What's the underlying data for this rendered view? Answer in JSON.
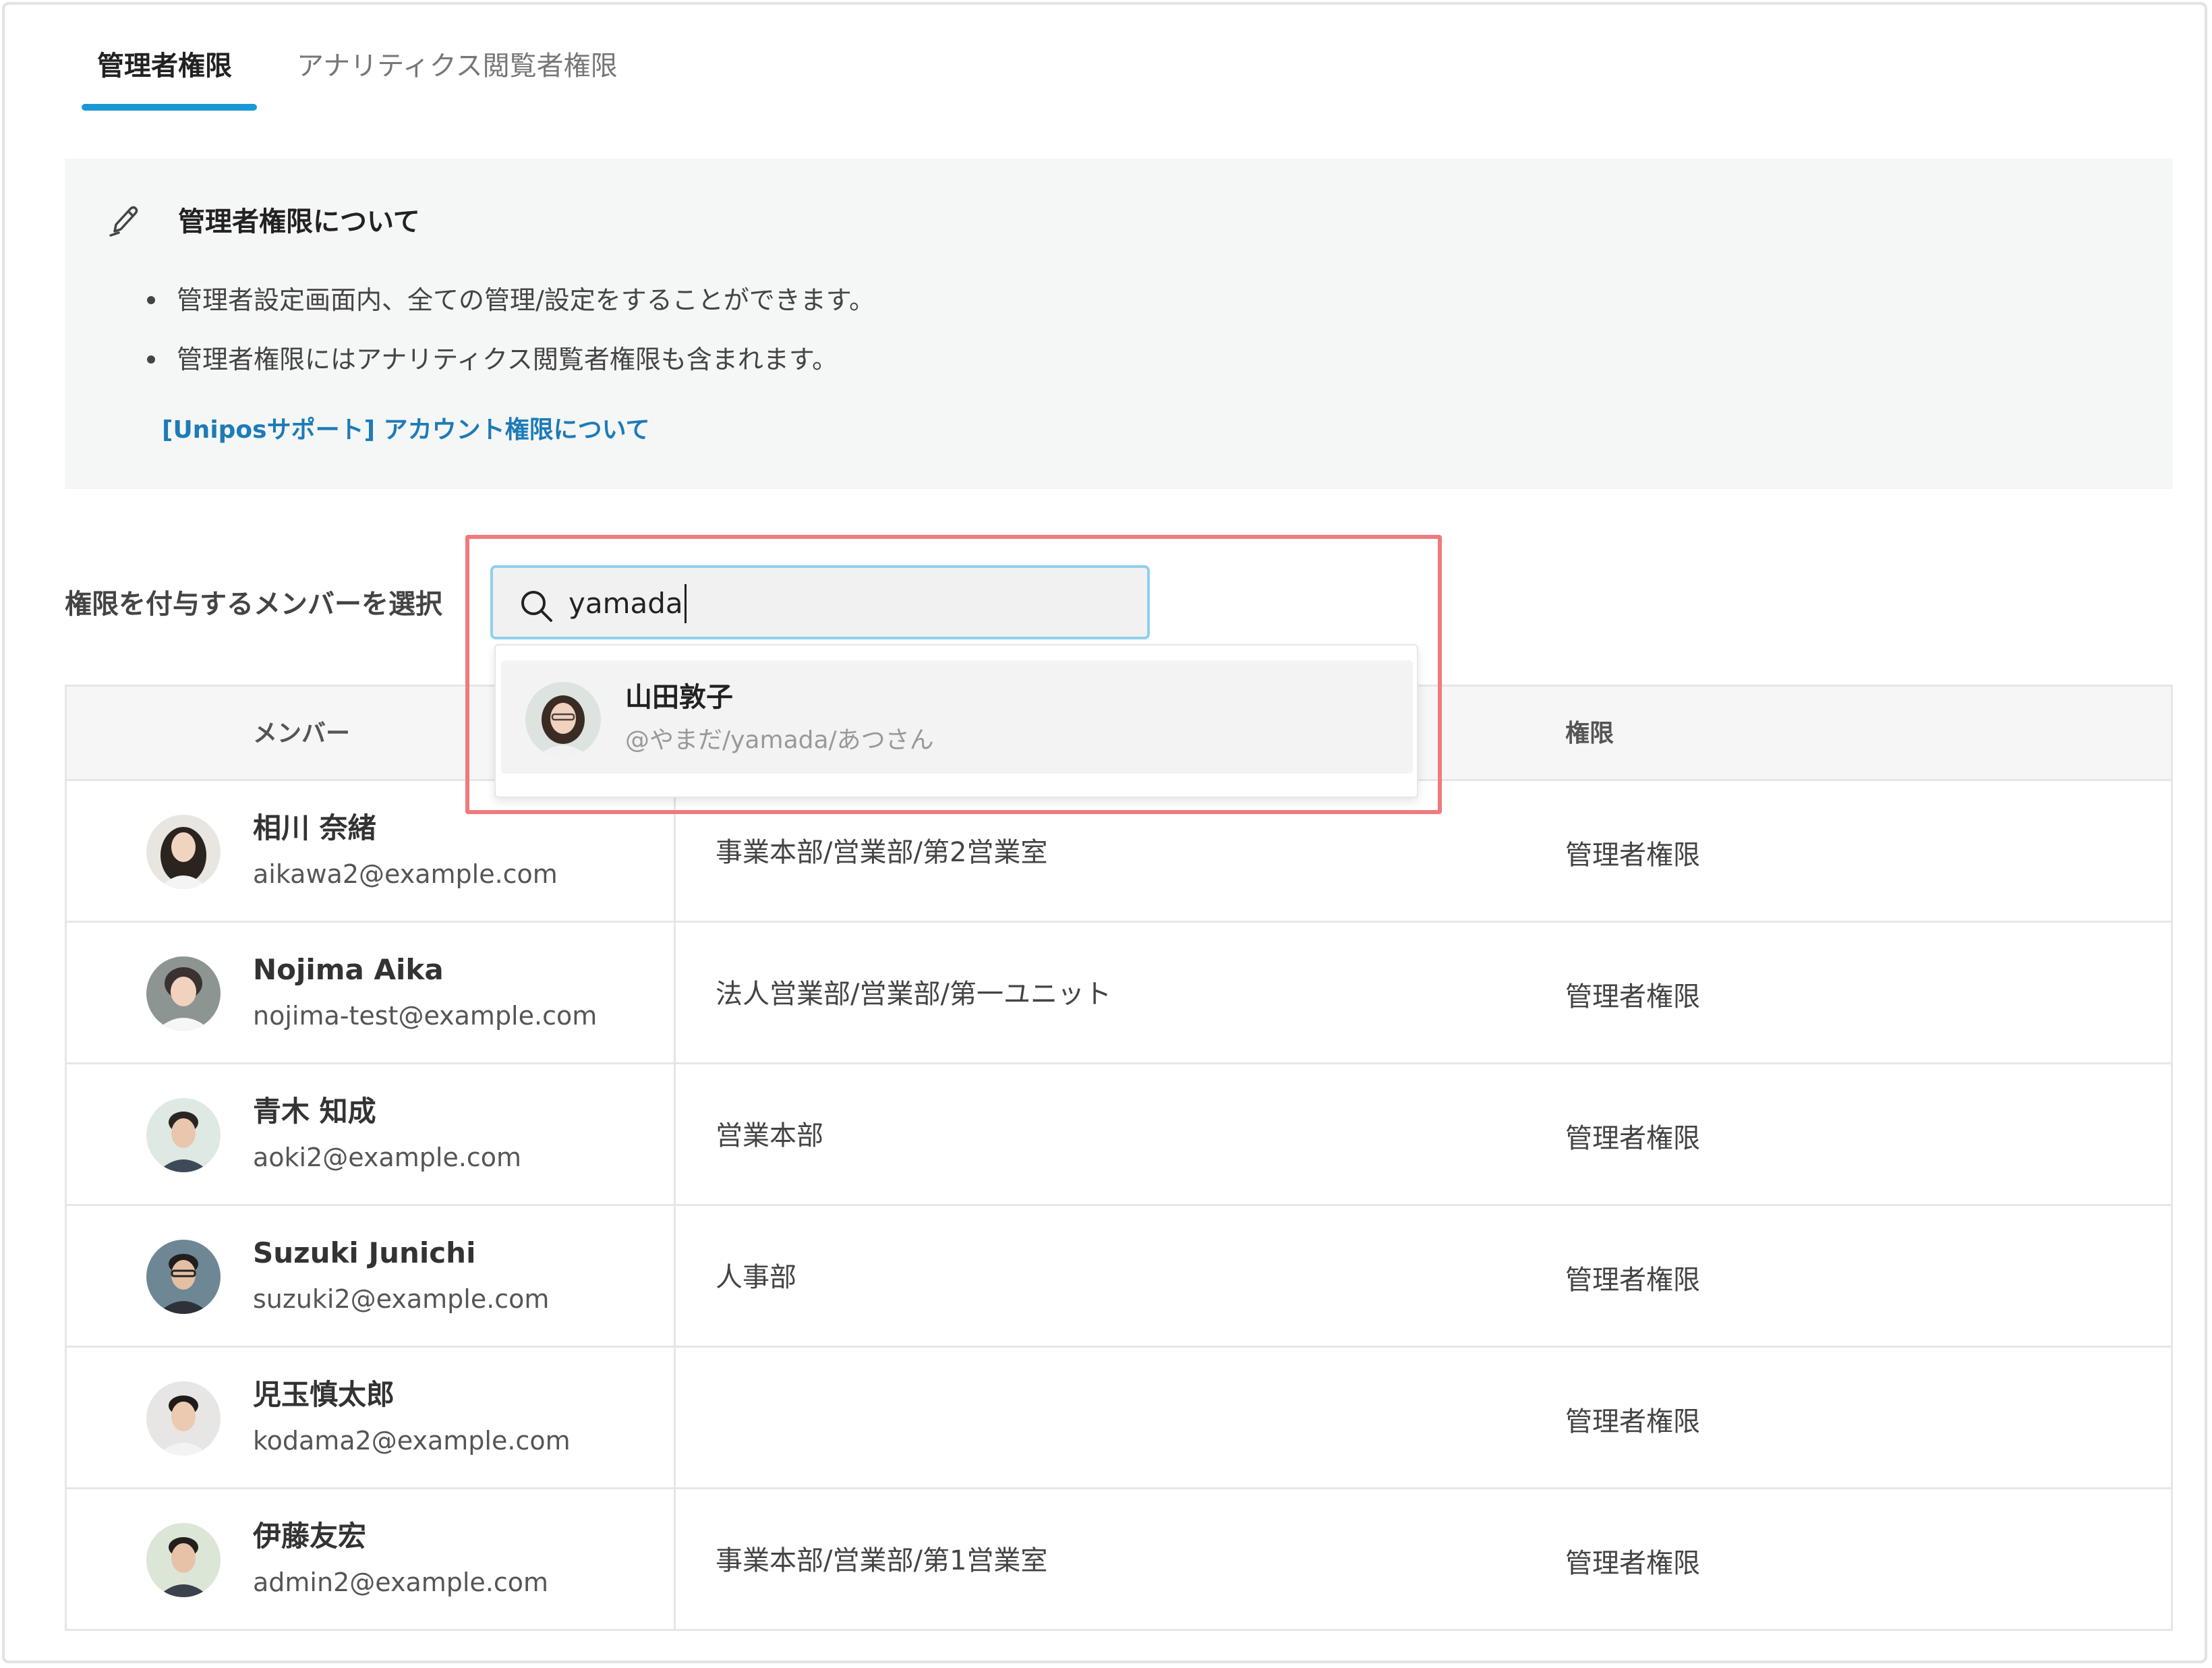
{
  "tabs": [
    {
      "label": "管理者権限",
      "active": true
    },
    {
      "label": "アナリティクス閲覧者権限",
      "active": false
    }
  ],
  "info": {
    "icon": "pencil-icon",
    "title": "管理者権限について",
    "bullets": [
      "管理者設定画面内、全ての管理/設定をすることができます。",
      "管理者権限にはアナリティクス閲覧者権限も含まれます。"
    ],
    "link": "[Uniposサポート] アカウント権限について"
  },
  "select": {
    "label": "権限を付与するメンバーを選択",
    "search_value": "yamada",
    "search_icon": "search-icon"
  },
  "suggestion": {
    "name": "山田敦子",
    "sub": "@やまだ/yamada/あつさん"
  },
  "table": {
    "headers": {
      "member": "メンバー",
      "role": "権限"
    },
    "rows": [
      {
        "name": "相川 奈緒",
        "email": "aikawa2@example.com",
        "dept": "事業本部/営業部/第2営業室",
        "role": "管理者権限"
      },
      {
        "name": "Nojima Aika",
        "email": "nojima-test@example.com",
        "dept": "法人営業部/営業部/第一ユニット",
        "role": "管理者権限"
      },
      {
        "name": "青木 知成",
        "email": "aoki2@example.com",
        "dept": "営業本部",
        "role": "管理者権限"
      },
      {
        "name": "Suzuki Junichi",
        "email": "suzuki2@example.com",
        "dept": "人事部",
        "role": "管理者権限"
      },
      {
        "name": "児玉慎太郎",
        "email": "kodama2@example.com",
        "dept": "",
        "role": "管理者権限"
      },
      {
        "name": "伊藤友宏",
        "email": "admin2@example.com",
        "dept": "事業本部/営業部/第1営業室",
        "role": "管理者権限"
      }
    ]
  },
  "colors": {
    "accent": "#1a98d5",
    "link": "#1d7bb8",
    "highlight": "#ef7a7d",
    "search_border": "#8fd0ef"
  }
}
